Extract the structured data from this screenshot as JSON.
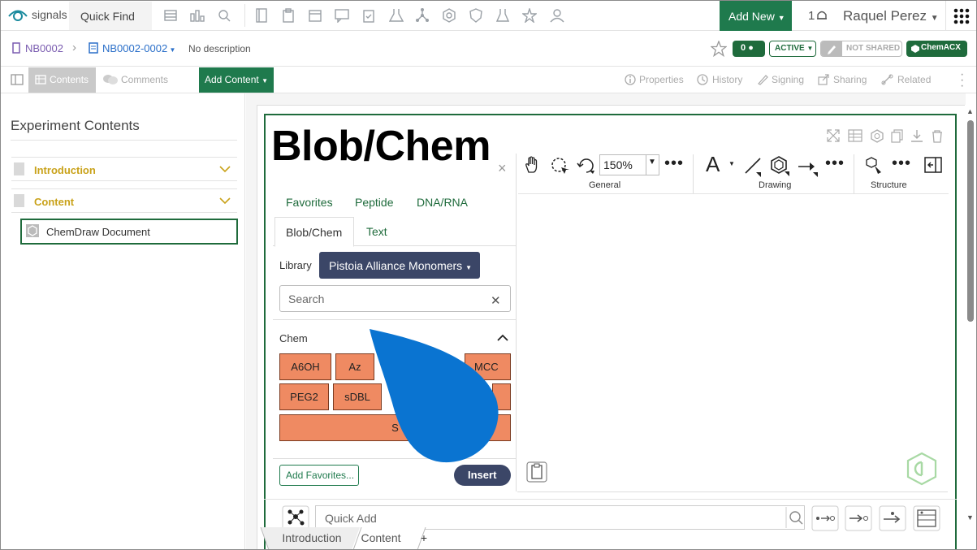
{
  "topbar": {
    "logo_text": "signals",
    "quick_find": "Quick Find",
    "add_new": "Add New",
    "notification_count": "1",
    "user_name": "Raquel Perez"
  },
  "breadcrumb": {
    "notebook": "NB0002",
    "entry": "NB0002-0002",
    "description": "No description",
    "comment_count": "0",
    "status": "ACTIVE",
    "sharing": "NOT SHARED",
    "chemacx": "ChemACX"
  },
  "toolbar": {
    "contents": "Contents",
    "comments": "Comments",
    "add_content": "Add Content",
    "properties": "Properties",
    "history": "History",
    "signing": "Signing",
    "sharing": "Sharing",
    "related": "Related"
  },
  "left_panel": {
    "title": "Experiment Contents",
    "sections": [
      {
        "label": "Introduction"
      },
      {
        "label": "Content"
      }
    ],
    "document": "ChemDraw Document"
  },
  "overlay_title": "Blob/Chem",
  "palette": {
    "tabs_row1": [
      "Favorites",
      "Peptide",
      "DNA/RNA"
    ],
    "tab_active": "Blob/Chem",
    "tab_text": "Text",
    "library_label": "Library",
    "library_value": "Pistoia Alliance Monomers",
    "search_placeholder": "Search",
    "section_label": "Chem",
    "monomers": [
      "A6OH",
      "Az",
      "MCC",
      "PEG2",
      "sDBL",
      "S"
    ],
    "add_favorites": "Add Favorites...",
    "insert": "Insert"
  },
  "chemdraw": {
    "zoom": "150%",
    "groups": [
      "General",
      "Drawing",
      "Structure"
    ],
    "quick_add_placeholder": "Quick Add"
  },
  "bottom_tabs": [
    "Introduction",
    "Content",
    "+"
  ],
  "colors": {
    "brand_green": "#1f7a4d",
    "monomer_orange": "#ef8a62",
    "navy_button": "#3b4667",
    "section_gold": "#c9a21a",
    "drop_blue": "#0a74d1"
  }
}
